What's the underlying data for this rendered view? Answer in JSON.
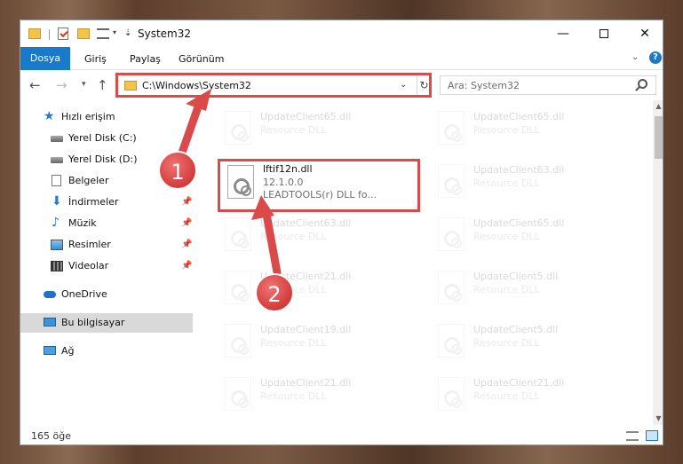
{
  "window": {
    "title": "System32",
    "minimize_glyph": "—",
    "close_glyph": "✕"
  },
  "ribbon": {
    "tabs": [
      "Dosya",
      "Giriş",
      "Paylaş",
      "Görünüm"
    ]
  },
  "address": {
    "path": "C:\\Windows\\System32"
  },
  "search": {
    "placeholder": "Ara: System32"
  },
  "sidebar": {
    "items": [
      {
        "label": "Hızlı erişim",
        "icon": "star-icon"
      },
      {
        "label": "Yerel Disk (C:)",
        "icon": "disk-icon"
      },
      {
        "label": "Yerel Disk (D:)",
        "icon": "disk-icon"
      },
      {
        "label": "Belgeler",
        "icon": "documents-icon"
      },
      {
        "label": "İndirmeler",
        "icon": "download-icon"
      },
      {
        "label": "Müzik",
        "icon": "music-icon"
      },
      {
        "label": "Resimler",
        "icon": "pictures-icon"
      },
      {
        "label": "Videolar",
        "icon": "video-icon"
      },
      {
        "label": "OneDrive",
        "icon": "cloud-icon"
      },
      {
        "label": "Bu bilgisayar",
        "icon": "computer-icon"
      },
      {
        "label": "Ağ",
        "icon": "network-icon"
      }
    ]
  },
  "files": {
    "left": [
      {
        "name": "UpdateClient65.dll",
        "type": "Resource DLL"
      },
      {
        "name": "UpdateClient63.dll",
        "type": "Resource DLL"
      },
      {
        "name": "UpdateClient19.dll",
        "type": "Resource DLL"
      },
      {
        "name": "UpdateClient21.dll",
        "type": "Resource DLL"
      },
      {
        "name": "UpdateClient21.dll",
        "type": "Resource DLL"
      }
    ],
    "right": [
      {
        "name": "UpdateClient65.dll",
        "type": "Resource DLL"
      },
      {
        "name": "UpdateClient63.dll",
        "type": "Resource DLL"
      },
      {
        "name": "UpdateClient65.dll",
        "type": "Resource DLL"
      },
      {
        "name": "UpdateClient5.dll",
        "type": "Resource DLL"
      },
      {
        "name": "UpdateClient5.dll",
        "type": "Resource DLL"
      },
      {
        "name": "UpdateClient21.dll",
        "type": "Resource DLL"
      }
    ],
    "highlighted": {
      "name": "lftif12n.dll",
      "version": "12.1.0.0",
      "description": "LEADTOOLS(r) DLL fo..."
    }
  },
  "status": {
    "count": "165 öğe"
  },
  "annotations": {
    "step1": "1",
    "step2": "2"
  },
  "colors": {
    "accent": "#1979ca",
    "annotation": "#d94a4a"
  }
}
